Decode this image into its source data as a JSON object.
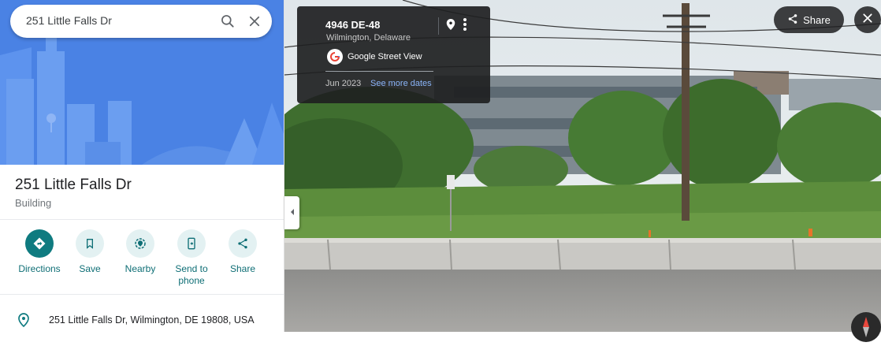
{
  "search": {
    "value": "251 Little Falls Dr"
  },
  "place": {
    "title": "251 Little Falls Dr",
    "type": "Building"
  },
  "actions": [
    {
      "label": "Directions"
    },
    {
      "label": "Save"
    },
    {
      "label": "Nearby"
    },
    {
      "label": "Send to phone"
    },
    {
      "label": "Share"
    }
  ],
  "address": "251 Little Falls Dr, Wilmington, DE 19808, USA",
  "streetview": {
    "title": "4946 DE-48",
    "subtitle": "Wilmington, Delaware",
    "provider": "Google Street View",
    "date": "Jun 2023",
    "more_dates": "See more dates",
    "share_label": "Share"
  },
  "colors": {
    "accent": "#0f7b80",
    "hero": "#4a82e4"
  },
  "icons": [
    "search-icon",
    "close-icon",
    "directions-icon",
    "bookmark-icon",
    "nearby-icon",
    "send-to-phone-icon",
    "share-icon",
    "location-pin-icon",
    "chevron-left-icon",
    "compass-icon"
  ]
}
